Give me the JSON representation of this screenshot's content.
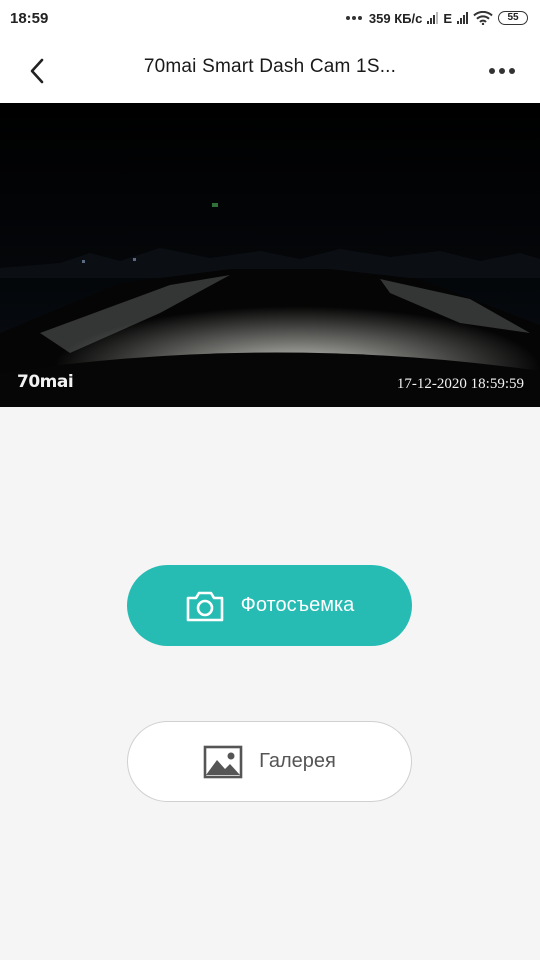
{
  "status_bar": {
    "time": "18:59",
    "network_speed": "359 КБ/с",
    "network_type": "E",
    "battery": "55"
  },
  "header": {
    "title": "70mai Smart Dash Cam 1S..."
  },
  "camera": {
    "logo_text": "70mai",
    "timestamp": "17-12-2020 18:59:59"
  },
  "actions": {
    "photo_label": "Фотосъемка",
    "gallery_label": "Галерея"
  },
  "colors": {
    "accent": "#27bcb3",
    "background": "#f5f5f5"
  },
  "icons": [
    "back-icon",
    "more-icon",
    "camera-icon",
    "gallery-icon",
    "wifi-icon",
    "signal-icon",
    "battery-icon"
  ]
}
